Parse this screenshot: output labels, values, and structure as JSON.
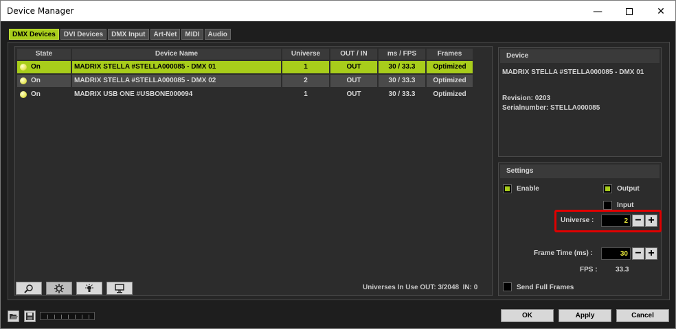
{
  "window": {
    "title": "Device Manager"
  },
  "tabs": [
    "DMX Devices",
    "DVI Devices",
    "DMX Input",
    "Art-Net",
    "MIDI",
    "Audio"
  ],
  "active_tab": "DMX Devices",
  "table": {
    "headers": {
      "state": "State",
      "name": "Device Name",
      "universe": "Universe",
      "out_in": "OUT / IN",
      "ms_fps": "ms / FPS",
      "frames": "Frames"
    },
    "rows": [
      {
        "state": "On",
        "name": "MADRIX STELLA #STELLA000085 - DMX 01",
        "universe": "1",
        "out_in": "OUT",
        "ms_fps": "30 / 33.3",
        "frames": "Optimized"
      },
      {
        "state": "On",
        "name": "MADRIX STELLA #STELLA000085 - DMX 02",
        "universe": "2",
        "out_in": "OUT",
        "ms_fps": "30 / 33.3",
        "frames": "Optimized"
      },
      {
        "state": "On",
        "name": "MADRIX USB ONE #USBONE000094",
        "universe": "1",
        "out_in": "OUT",
        "ms_fps": "30 / 33.3",
        "frames": "Optimized"
      }
    ]
  },
  "toolbar": {
    "icons": [
      "search-icon",
      "gear-icon",
      "bulb-icon",
      "monitor-icon"
    ]
  },
  "status": {
    "text": "Universes In Use OUT: 3/2048  IN: 0"
  },
  "device": {
    "header": "Device",
    "name": "MADRIX STELLA #STELLA000085 - DMX 01",
    "revision": "Revision: 0203",
    "serial": "Serialnumber: STELLA000085"
  },
  "settings": {
    "header": "Settings",
    "enable_label": "Enable",
    "enable_checked": true,
    "output_label": "Output",
    "output_checked": true,
    "input_label": "Input",
    "input_checked": false,
    "universe_label": "Universe :",
    "universe_value": "2",
    "frame_time_label": "Frame Time (ms) :",
    "frame_time_value": "30",
    "fps_label": "FPS :",
    "fps_value": "33.3",
    "send_full_frames_label": "Send Full Frames",
    "send_full_frames_checked": false,
    "minus": "−",
    "plus": "+"
  },
  "buttons": {
    "ok": "OK",
    "apply": "Apply",
    "cancel": "Cancel"
  },
  "colors": {
    "accent": "#a8cd1b",
    "highlight_box": "#e00000",
    "background": "#1e1e1e"
  }
}
